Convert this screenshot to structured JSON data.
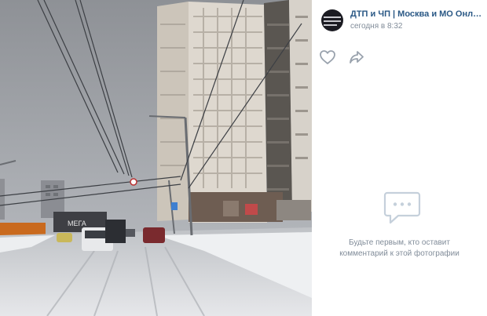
{
  "post": {
    "group_name": "ДТП и ЧП | Москва и МО Онлайн | ...",
    "timestamp": "сегодня в 8:32"
  },
  "actions": [
    {
      "name": "like",
      "icon": "heart-icon"
    },
    {
      "name": "share",
      "icon": "share-arrow-icon"
    }
  ],
  "comments": {
    "icon": "comment-bubble-icon",
    "empty_line1": "Будьте первым, кто оставит",
    "empty_line2": "комментарий к этой фотографии"
  },
  "photo": {
    "description_visible": false,
    "sign_text": "МЕГА"
  },
  "colors": {
    "link": "#2a5885",
    "muted": "#818c99",
    "icon": "#99a2ad"
  }
}
